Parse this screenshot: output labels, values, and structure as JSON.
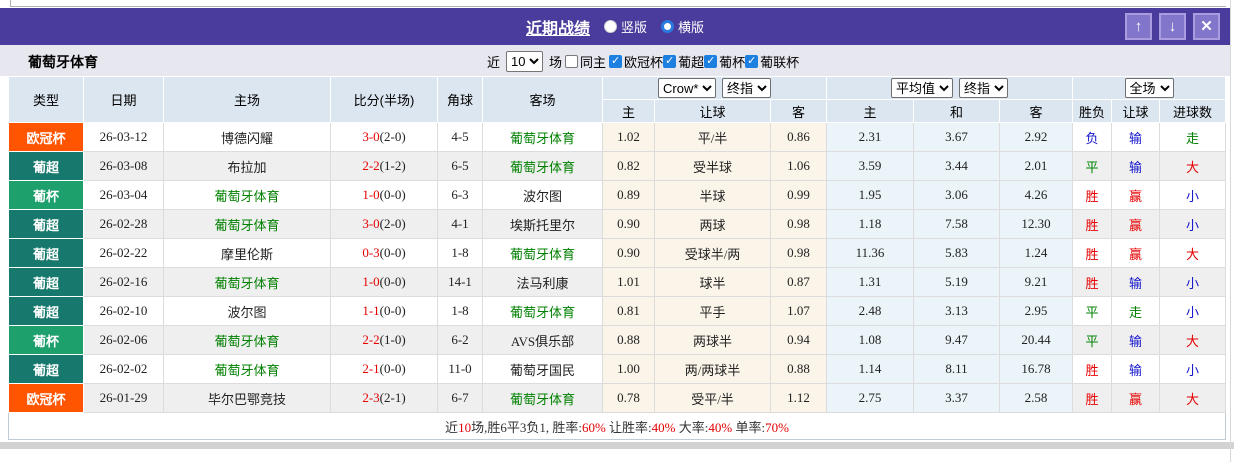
{
  "titlebar": {
    "title": "近期战绩",
    "radio_vertical": "竖版",
    "radio_horizontal": "横版",
    "selected_layout": "横版",
    "up_button": "↑",
    "down_button": "↓",
    "close_button": "✕"
  },
  "filterbar": {
    "team": "葡萄牙体育",
    "recent_prefix": "近",
    "recent_count": "10",
    "recent_suffix": "场",
    "same_home_label": "同主",
    "same_home_checked": false,
    "competitions": [
      {
        "label": "欧冠杯",
        "checked": true
      },
      {
        "label": "葡超",
        "checked": true
      },
      {
        "label": "葡杯",
        "checked": true
      },
      {
        "label": "葡联杯",
        "checked": true
      }
    ]
  },
  "table": {
    "left_headers": [
      "类型",
      "日期",
      "主场",
      "比分(半场)",
      "角球",
      "客场"
    ],
    "group1": {
      "select1": "Crow*",
      "select2": "终指",
      "sub": [
        "主",
        "让球",
        "客"
      ]
    },
    "group2": {
      "select1": "平均值",
      "select2": "终指",
      "sub": [
        "主",
        "和",
        "客"
      ]
    },
    "group3": {
      "select1": "全场",
      "sub": [
        "胜负",
        "让球",
        "进球数"
      ]
    },
    "rows": [
      {
        "type": "欧冠杯",
        "type_color": "#ff5400",
        "date": "26-03-12",
        "home": "博德闪耀",
        "home_is_team": false,
        "score": "3-0",
        "half": "(2-0)",
        "corner": "4-5",
        "away": "葡萄牙体育",
        "away_is_team": true,
        "odds": [
          "1.02",
          "平/半",
          "0.86"
        ],
        "avg": [
          "2.31",
          "3.67",
          "2.92"
        ],
        "result": {
          "text": "负",
          "color": "blue"
        },
        "handicap": {
          "text": "输",
          "color": "blue"
        },
        "goals": {
          "text": "走",
          "color": "green"
        }
      },
      {
        "type": "葡超",
        "type_color": "#17796d",
        "date": "26-03-08",
        "home": "布拉加",
        "home_is_team": false,
        "score": "2-2",
        "half": "(1-2)",
        "corner": "6-5",
        "away": "葡萄牙体育",
        "away_is_team": true,
        "odds": [
          "0.82",
          "受半球",
          "1.06"
        ],
        "avg": [
          "3.59",
          "3.44",
          "2.01"
        ],
        "result": {
          "text": "平",
          "color": "green"
        },
        "handicap": {
          "text": "输",
          "color": "blue"
        },
        "goals": {
          "text": "大",
          "color": "red"
        }
      },
      {
        "type": "葡杯",
        "type_color": "#1da06c",
        "date": "26-03-04",
        "home": "葡萄牙体育",
        "home_is_team": true,
        "score": "1-0",
        "half": "(0-0)",
        "corner": "6-3",
        "away": "波尔图",
        "away_is_team": false,
        "odds": [
          "0.89",
          "半球",
          "0.99"
        ],
        "avg": [
          "1.95",
          "3.06",
          "4.26"
        ],
        "result": {
          "text": "胜",
          "color": "red"
        },
        "handicap": {
          "text": "赢",
          "color": "red"
        },
        "goals": {
          "text": "小",
          "color": "blue"
        }
      },
      {
        "type": "葡超",
        "type_color": "#17796d",
        "date": "26-02-28",
        "home": "葡萄牙体育",
        "home_is_team": true,
        "score": "3-0",
        "half": "(2-0)",
        "corner": "4-1",
        "away": "埃斯托里尔",
        "away_is_team": false,
        "odds": [
          "0.90",
          "两球",
          "0.98"
        ],
        "avg": [
          "1.18",
          "7.58",
          "12.30"
        ],
        "result": {
          "text": "胜",
          "color": "red"
        },
        "handicap": {
          "text": "赢",
          "color": "red"
        },
        "goals": {
          "text": "小",
          "color": "blue"
        }
      },
      {
        "type": "葡超",
        "type_color": "#17796d",
        "date": "26-02-22",
        "home": "摩里伦斯",
        "home_is_team": false,
        "score": "0-3",
        "half": "(0-0)",
        "corner": "1-8",
        "away": "葡萄牙体育",
        "away_is_team": true,
        "odds": [
          "0.90",
          "受球半/两",
          "0.98"
        ],
        "avg": [
          "11.36",
          "5.83",
          "1.24"
        ],
        "result": {
          "text": "胜",
          "color": "red"
        },
        "handicap": {
          "text": "赢",
          "color": "red"
        },
        "goals": {
          "text": "大",
          "color": "red"
        }
      },
      {
        "type": "葡超",
        "type_color": "#17796d",
        "date": "26-02-16",
        "home": "葡萄牙体育",
        "home_is_team": true,
        "score": "1-0",
        "half": "(0-0)",
        "corner": "14-1",
        "away": "法马利康",
        "away_is_team": false,
        "odds": [
          "1.01",
          "球半",
          "0.87"
        ],
        "avg": [
          "1.31",
          "5.19",
          "9.21"
        ],
        "result": {
          "text": "胜",
          "color": "red"
        },
        "handicap": {
          "text": "输",
          "color": "blue"
        },
        "goals": {
          "text": "小",
          "color": "blue"
        }
      },
      {
        "type": "葡超",
        "type_color": "#17796d",
        "date": "26-02-10",
        "home": "波尔图",
        "home_is_team": false,
        "score": "1-1",
        "half": "(0-0)",
        "corner": "1-8",
        "away": "葡萄牙体育",
        "away_is_team": true,
        "odds": [
          "0.81",
          "平手",
          "1.07"
        ],
        "avg": [
          "2.48",
          "3.13",
          "2.95"
        ],
        "result": {
          "text": "平",
          "color": "green"
        },
        "handicap": {
          "text": "走",
          "color": "green"
        },
        "goals": {
          "text": "小",
          "color": "blue"
        }
      },
      {
        "type": "葡杯",
        "type_color": "#1da06c",
        "date": "26-02-06",
        "home": "葡萄牙体育",
        "home_is_team": true,
        "score": "2-2",
        "half": "(1-0)",
        "corner": "6-2",
        "away": "AVS俱乐部",
        "away_is_team": false,
        "odds": [
          "0.88",
          "两球半",
          "0.94"
        ],
        "avg": [
          "1.08",
          "9.47",
          "20.44"
        ],
        "result": {
          "text": "平",
          "color": "green"
        },
        "handicap": {
          "text": "输",
          "color": "blue"
        },
        "goals": {
          "text": "大",
          "color": "red"
        }
      },
      {
        "type": "葡超",
        "type_color": "#17796d",
        "date": "26-02-02",
        "home": "葡萄牙体育",
        "home_is_team": true,
        "score": "2-1",
        "half": "(0-0)",
        "corner": "11-0",
        "away": "葡萄牙国民",
        "away_is_team": false,
        "odds": [
          "1.00",
          "两/两球半",
          "0.88"
        ],
        "avg": [
          "1.14",
          "8.11",
          "16.78"
        ],
        "result": {
          "text": "胜",
          "color": "red"
        },
        "handicap": {
          "text": "输",
          "color": "blue"
        },
        "goals": {
          "text": "小",
          "color": "blue"
        }
      },
      {
        "type": "欧冠杯",
        "type_color": "#ff5400",
        "date": "26-01-29",
        "home": "毕尔巴鄂竞技",
        "home_is_team": false,
        "score": "2-3",
        "half": "(2-1)",
        "corner": "6-7",
        "away": "葡萄牙体育",
        "away_is_team": true,
        "odds": [
          "0.78",
          "受平/半",
          "1.12"
        ],
        "avg": [
          "2.75",
          "3.37",
          "2.58"
        ],
        "result": {
          "text": "胜",
          "color": "red"
        },
        "handicap": {
          "text": "赢",
          "color": "red"
        },
        "goals": {
          "text": "大",
          "color": "red"
        }
      }
    ]
  },
  "summary": {
    "parts": [
      {
        "text": "近",
        "red": false
      },
      {
        "text": "10",
        "red": true
      },
      {
        "text": "场,胜6平3负1, 胜率:",
        "red": false
      },
      {
        "text": "60%",
        "red": true
      },
      {
        "text": " 让胜率:",
        "red": false
      },
      {
        "text": "40%",
        "red": true
      },
      {
        "text": " 大率:",
        "red": false
      },
      {
        "text": "40%",
        "red": true
      },
      {
        "text": " 单率:",
        "red": false
      },
      {
        "text": "70%",
        "red": true
      }
    ]
  },
  "colors": {
    "titlebar_bg": "#4a3c9c",
    "type_champions_league": "#ff5400",
    "type_liga_portugal": "#17796d",
    "type_portugal_cup": "#1da06c",
    "team_highlight": "#008000",
    "win_red": "#e60000",
    "draw_green": "#008000",
    "lose_blue": "#1414cc",
    "crow_col_bg": "#fbf4e9",
    "avg_col_bg": "#eaf4f9"
  }
}
